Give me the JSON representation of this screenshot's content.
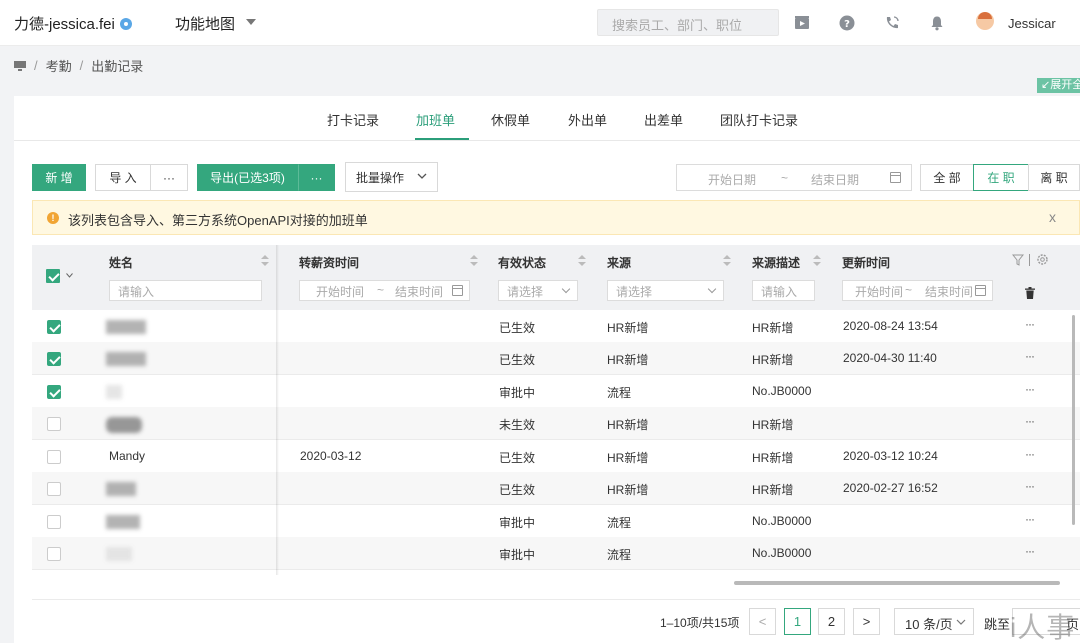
{
  "header": {
    "brand": "力德-jessica.fei",
    "func_map": "功能地图",
    "search_placeholder": "搜索员工、部门、职位",
    "user": "Jessicar"
  },
  "breadcrumb": [
    "考勤",
    "出勤记录"
  ],
  "expand_label": "↙展开全",
  "tabs": [
    {
      "label": "打卡记录"
    },
    {
      "label": "加班单"
    },
    {
      "label": "休假单"
    },
    {
      "label": "外出单"
    },
    {
      "label": "出差单"
    },
    {
      "label": "团队打卡记录"
    }
  ],
  "active_tab": "加班单",
  "toolbar": {
    "add": "新 增",
    "import": "导 入",
    "import_more": "···",
    "export": "导出(已选3项)",
    "export_more": "···",
    "batch": "批量操作",
    "date_start": "开始日期",
    "date_tilde": "~",
    "date_end": "结束日期",
    "seg_all": "全 部",
    "seg_active": "在 职",
    "seg_left": "离 职"
  },
  "alert": {
    "icon": "!",
    "text": "该列表包含导入、第三方系统OpenAPI对接的加班单",
    "close": "x"
  },
  "columns": {
    "name": "姓名",
    "salary_time": "转薪资时间",
    "status": "有效状态",
    "source": "来源",
    "source_desc": "来源描述",
    "update_time": "更新时间"
  },
  "filters": {
    "name": "请输入",
    "salary_start": "开始时间",
    "salary_tilde": "~",
    "salary_end": "结束时间",
    "status": "请选择",
    "source": "请选择",
    "source_desc": "请输入",
    "update_start": "开始时间",
    "update_tilde": "~",
    "update_end": "结束时间"
  },
  "rows": [
    {
      "checked": true,
      "name": "",
      "salary_time": "",
      "status": "已生效",
      "source": "HR新增",
      "source_desc": "HR新增",
      "update_time": "2020-08-24 13:54"
    },
    {
      "checked": true,
      "name": "",
      "salary_time": "",
      "status": "已生效",
      "source": "HR新增",
      "source_desc": "HR新增",
      "update_time": "2020-04-30 11:40"
    },
    {
      "checked": true,
      "name": "",
      "salary_time": "",
      "status": "审批中",
      "source": "流程",
      "source_desc": "No.JB0000",
      "update_time": ""
    },
    {
      "checked": false,
      "name": "",
      "salary_time": "",
      "status": "未生效",
      "source": "HR新增",
      "source_desc": "HR新增",
      "update_time": ""
    },
    {
      "checked": false,
      "name": "Mandy",
      "salary_time": "2020-03-12",
      "status": "已生效",
      "source": "HR新增",
      "source_desc": "HR新增",
      "update_time": "2020-03-12 10:24"
    },
    {
      "checked": false,
      "name": "",
      "salary_time": "",
      "status": "已生效",
      "source": "HR新增",
      "source_desc": "HR新增",
      "update_time": "2020-02-27 16:52"
    },
    {
      "checked": false,
      "name": "",
      "salary_time": "",
      "status": "审批中",
      "source": "流程",
      "source_desc": "No.JB0000",
      "update_time": ""
    },
    {
      "checked": false,
      "name": "",
      "salary_time": "",
      "status": "审批中",
      "source": "流程",
      "source_desc": "No.JB0000",
      "update_time": ""
    }
  ],
  "row_more": "···",
  "pagination": {
    "info": "1–10项/共15项",
    "prev": "<",
    "pages": [
      "1",
      "2"
    ],
    "current": "1",
    "next": ">",
    "page_size": "10 条/页",
    "jump_label": "跳至",
    "jump_suffix": "页"
  },
  "watermark": "i人事",
  "colors": {
    "accent": "#34a77e",
    "alert_bg": "#fff8e1",
    "alert_icon": "#f1a534"
  }
}
